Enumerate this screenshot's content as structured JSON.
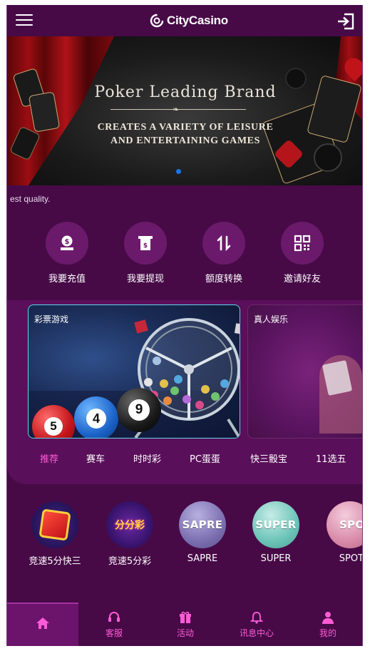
{
  "header": {
    "brand_name": "CityCasino",
    "menu_icon": "hamburger-menu-icon",
    "login_icon": "login-icon"
  },
  "banner": {
    "title": "Poker Leading Brand",
    "subtitle_line1": "CREATES A VARIETY OF LEISURE",
    "subtitle_line2": "AND ENTERTAINING GAMES",
    "active_slide": 1,
    "slide_count": 2,
    "dot_active_color": "#1a73e8"
  },
  "marquee": {
    "text": "est quality."
  },
  "actions": [
    {
      "label": "我要充值",
      "icon": "deposit-icon"
    },
    {
      "label": "我要提现",
      "icon": "withdraw-icon"
    },
    {
      "label": "额度转换",
      "icon": "transfer-icon"
    },
    {
      "label": "邀请好友",
      "icon": "qr-code-icon"
    }
  ],
  "tiles": [
    {
      "label": "彩票游戏"
    },
    {
      "label": "真人娱乐"
    }
  ],
  "lottery_balls": [
    "5",
    "4",
    "9"
  ],
  "tabs": [
    {
      "label": "推荐",
      "active": true
    },
    {
      "label": "赛车"
    },
    {
      "label": "时时彩"
    },
    {
      "label": "PC蛋蛋"
    },
    {
      "label": "快三骰宝"
    },
    {
      "label": "11选五"
    }
  ],
  "games": [
    {
      "label": "竞速5分快三",
      "icon": "dice-game-icon"
    },
    {
      "label": "竞速5分彩",
      "icon": "lottery-game-icon",
      "badge": "分分彩"
    },
    {
      "label": "SAPRE",
      "pill": "SAPRE",
      "color": "#7b6fb0"
    },
    {
      "label": "SUPER",
      "pill": "SUPER",
      "color": "#6cc4b8"
    },
    {
      "label": "SPOTS",
      "pill": "SPOT",
      "color": "#d98aa8"
    }
  ],
  "bottom_nav": [
    {
      "label": "",
      "icon": "home-icon",
      "active": true
    },
    {
      "label": "客服",
      "icon": "headset-icon"
    },
    {
      "label": "活动",
      "icon": "gift-icon"
    },
    {
      "label": "讯息中心",
      "icon": "bell-icon"
    },
    {
      "label": "我的",
      "icon": "user-icon"
    }
  ],
  "colors": {
    "background": "#470a47",
    "panel": "#5a0f5a",
    "accent_pink": "#ff5bd6",
    "tile_border": "#5fd6ea"
  }
}
